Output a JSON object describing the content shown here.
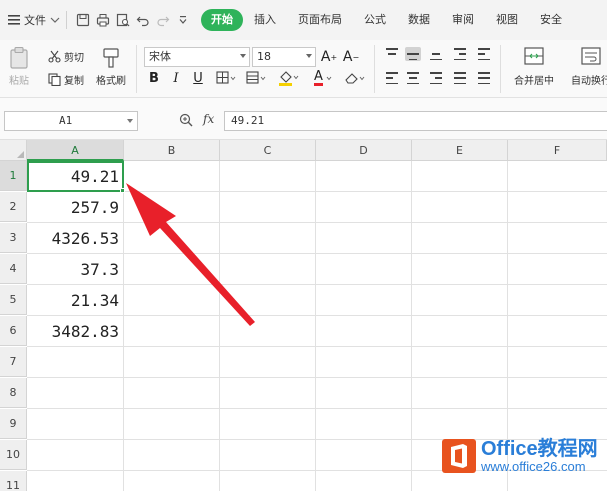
{
  "menubar": {
    "file_label": "文件",
    "tabs": [
      "开始",
      "插入",
      "页面布局",
      "公式",
      "数据",
      "审阅",
      "视图",
      "安全"
    ],
    "active_tab": "开始",
    "accent_color": "#2eb35a"
  },
  "ribbon": {
    "paste_label": "粘贴",
    "cut_label": "剪切",
    "copy_label": "复制",
    "format_painter_label": "格式刷",
    "font_name": "宋体",
    "font_size": "18",
    "bold_label": "B",
    "italic_label": "I",
    "underline_label": "U",
    "grow_font_label": "A",
    "shrink_font_label": "A",
    "font_color_label": "A",
    "merge_center_label": "合并居中",
    "wrap_label": "自动换行"
  },
  "formula_bar": {
    "name_box": "A1",
    "fx_label": "fx",
    "value": "49.21"
  },
  "sheet": {
    "columns": [
      "A",
      "B",
      "C",
      "D",
      "E",
      "F"
    ],
    "rows": [
      "1",
      "2",
      "3",
      "4",
      "5",
      "6",
      "7",
      "8",
      "9",
      "10",
      "11"
    ],
    "column_a_values": [
      "49.21",
      "257.9",
      "4326.53",
      "37.3",
      "21.34",
      "3482.83"
    ],
    "selected_cell": "A1",
    "selection_color": "#2e9e4e"
  },
  "annotation": {
    "arrow_color": "#e8202a"
  },
  "watermark": {
    "line1": "Office教程网",
    "line2": "www.office26.com",
    "logo_color": "#e8531f"
  }
}
